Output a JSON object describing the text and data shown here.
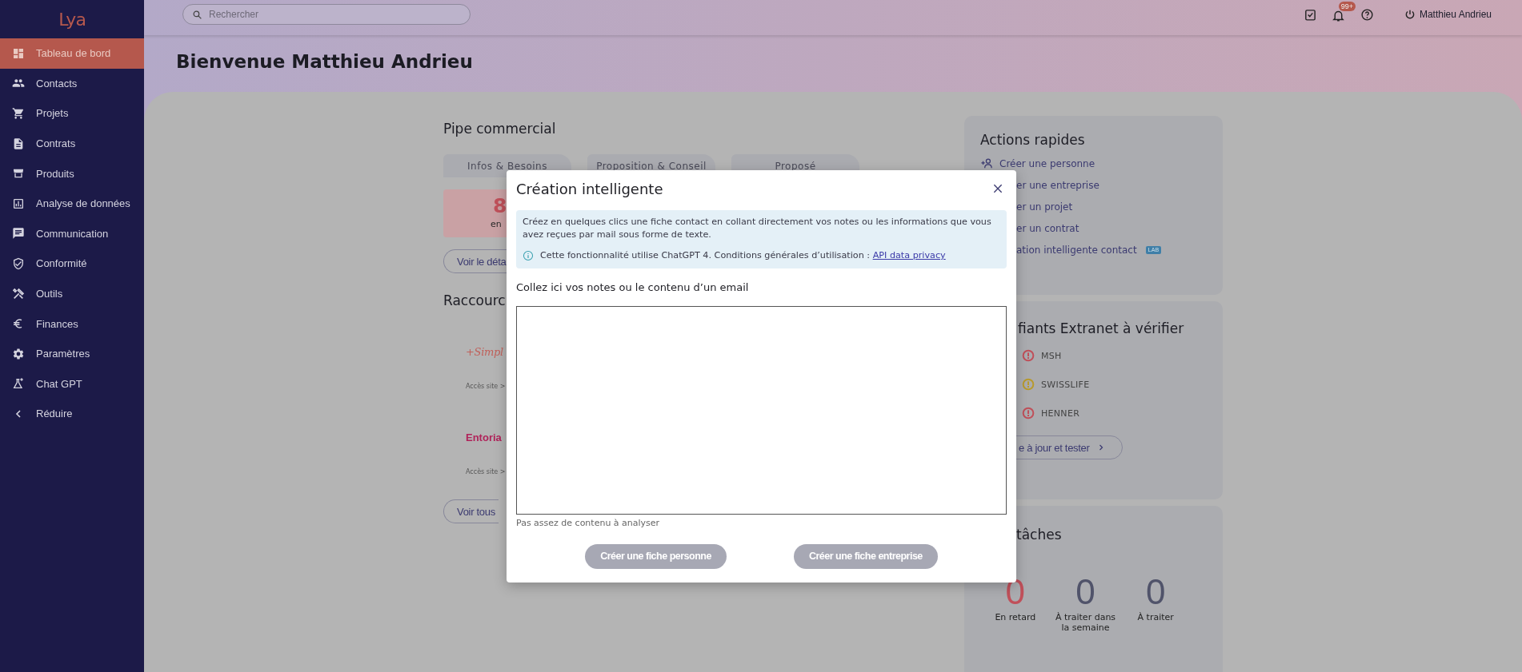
{
  "sidebar": {
    "logo": "Lya",
    "items": [
      {
        "label": "Tableau de bord",
        "selected": true
      },
      {
        "label": "Contacts",
        "selected": false
      },
      {
        "label": "Projets",
        "selected": false
      },
      {
        "label": "Contrats",
        "selected": false
      },
      {
        "label": "Produits",
        "selected": false
      },
      {
        "label": "Analyse de données",
        "selected": false
      },
      {
        "label": "Communication",
        "selected": false
      },
      {
        "label": "Conformité",
        "selected": false
      },
      {
        "label": "Outils",
        "selected": false
      },
      {
        "label": "Finances",
        "selected": false
      },
      {
        "label": "Paramètres",
        "selected": false
      },
      {
        "label": "Chat GPT",
        "selected": false
      }
    ],
    "collapse": "Réduire"
  },
  "topbar": {
    "search": {
      "placeholder": "Rechercher"
    },
    "notification_badge": "99+",
    "user": "Matthieu Andrieu"
  },
  "page_title": "Bienvenue Matthieu Andrieu",
  "pipeline": {
    "title": "Pipe commercial",
    "stages": [
      {
        "label": "Infos & Besoins"
      },
      {
        "label": "Proposition & Conseil"
      },
      {
        "label": "Proposé"
      }
    ],
    "summary": {
      "count": "8",
      "caption": "en"
    },
    "detail_button": "Voir le déta"
  },
  "shortcuts": {
    "title": "Raccourc",
    "items": [
      {
        "logo": "+Simpl",
        "kind": "script",
        "link": "Accès site >"
      },
      {
        "logo": "Entoria",
        "kind": "bold",
        "link": "Accès site >"
      }
    ],
    "all_button": "Voir tous"
  },
  "quick_actions": {
    "title": "Actions rapides",
    "items": [
      {
        "label": "Créer une personne",
        "kind": "icon"
      },
      {
        "label": "er une entreprise",
        "kind": "covered"
      },
      {
        "label": "er un projet",
        "kind": "covered"
      },
      {
        "label": "er un contrat",
        "kind": "covered"
      },
      {
        "label": "ation intelligente contact",
        "kind": "covered",
        "badge": "LAB"
      }
    ]
  },
  "extranet": {
    "title": "fiants Extranet à vérifier",
    "items": [
      {
        "label": "MSH",
        "color": "#c0505a"
      },
      {
        "label": "SWISSLIFE",
        "color": "#b89a2e"
      },
      {
        "label": "HENNER",
        "color": "#c0505a"
      }
    ],
    "button": "e à jour et tester"
  },
  "tasks": {
    "title": "tâches",
    "stats": [
      {
        "value": "0",
        "label": "En retard",
        "color": "#c0505a"
      },
      {
        "value": "0",
        "label": "À traiter dans la semaine",
        "color": "#50536a"
      },
      {
        "value": "0",
        "label": "À traiter",
        "color": "#50536a"
      }
    ]
  },
  "modal": {
    "title": "Création intelligente",
    "intro": "Créez en quelques clics une fiche contact en collant directement vos notes ou les informations que vous avez reçues par mail sous forme de texte.",
    "notice": "Cette fonctionnalité utilise ChatGPT 4. Conditions générales d’utilisation : ",
    "notice_link": "API data privacy",
    "field_label": "Collez ici vos notes ou le contenu d’un email",
    "hint": "Pas assez de contenu à analyser",
    "buttons": [
      {
        "label": "Créer une fiche personne",
        "disabled": true
      },
      {
        "label": "Créer une fiche entreprise",
        "disabled": true
      }
    ]
  }
}
